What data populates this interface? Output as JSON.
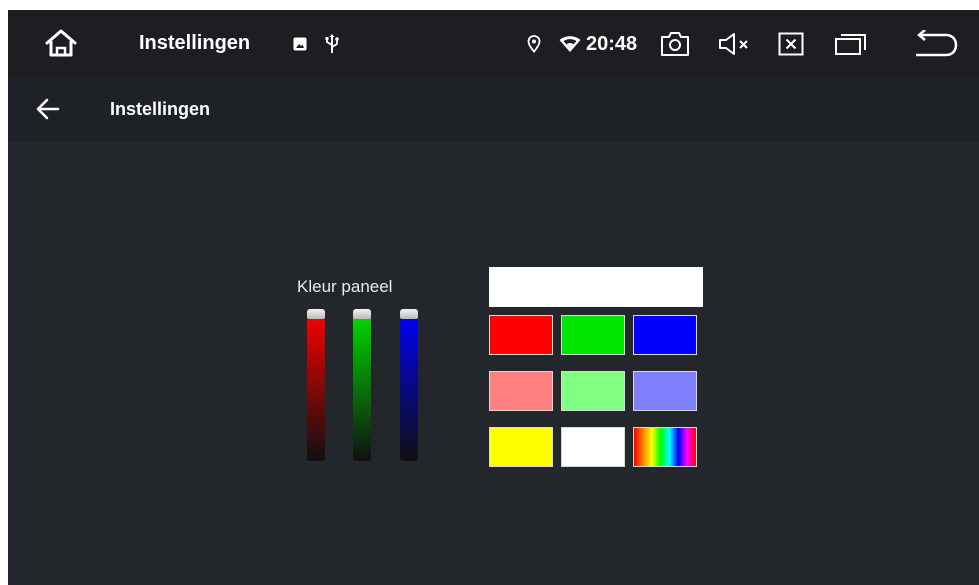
{
  "status_bar": {
    "app_title": "Instellingen",
    "time": "20:48",
    "icons": [
      "home-icon",
      "image-notification-icon",
      "usb-icon",
      "location-icon",
      "wifi-icon",
      "camera-icon",
      "volume-mute-icon",
      "close-window-icon",
      "recent-apps-icon",
      "back-icon"
    ]
  },
  "app_bar": {
    "title": "Instellingen",
    "back_icon": "arrow-left-icon"
  },
  "panel": {
    "label": "Kleur paneel",
    "preview_color": "#ffffff",
    "sliders": [
      {
        "name": "red",
        "color": "#ff0000",
        "level": 1.0
      },
      {
        "name": "green",
        "color": "#00e000",
        "level": 1.0
      },
      {
        "name": "blue",
        "color": "#0000ff",
        "level": 1.0
      }
    ],
    "swatches": [
      [
        "#ff0000",
        "#00e600",
        "#0000ff"
      ],
      [
        "#ff8080",
        "#80ff80",
        "#8080ff"
      ],
      [
        "#ffff00",
        "#ffffff",
        "rainbow"
      ]
    ]
  }
}
